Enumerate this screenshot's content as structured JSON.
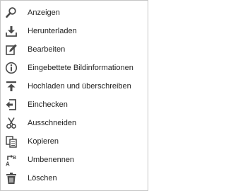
{
  "menu": {
    "items": [
      {
        "label": "Anzeigen",
        "icon": "magnifier-icon"
      },
      {
        "label": "Herunterladen",
        "icon": "download-icon"
      },
      {
        "label": "Bearbeiten",
        "icon": "edit-icon"
      },
      {
        "label": "Eingebettete Bildinformationen",
        "icon": "info-icon"
      },
      {
        "label": "Hochladen und überschreiben",
        "icon": "upload-icon"
      },
      {
        "label": "Einchecken",
        "icon": "check-in-icon"
      },
      {
        "label": "Ausschneiden",
        "icon": "scissors-icon"
      },
      {
        "label": "Kopieren",
        "icon": "copy-icon"
      },
      {
        "label": "Umbenennen",
        "icon": "rename-icon"
      },
      {
        "label": "Löschen",
        "icon": "trash-icon"
      }
    ]
  },
  "colors": {
    "text": "#222222",
    "icon": "#4a4a4a",
    "border": "#c6c6c6",
    "background": "#ffffff"
  }
}
